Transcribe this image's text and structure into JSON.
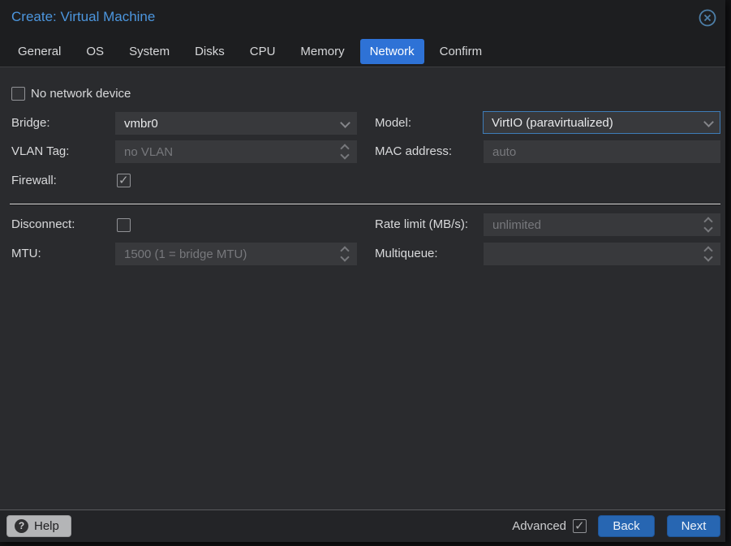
{
  "window": {
    "title": "Create: Virtual Machine"
  },
  "tabs": [
    {
      "label": "General",
      "active": false
    },
    {
      "label": "OS",
      "active": false
    },
    {
      "label": "System",
      "active": false
    },
    {
      "label": "Disks",
      "active": false
    },
    {
      "label": "CPU",
      "active": false
    },
    {
      "label": "Memory",
      "active": false
    },
    {
      "label": "Network",
      "active": true
    },
    {
      "label": "Confirm",
      "active": false
    }
  ],
  "form": {
    "no_network_device": {
      "label": "No network device",
      "checked": false
    },
    "bridge": {
      "label": "Bridge:",
      "value": "vmbr0"
    },
    "model": {
      "label": "Model:",
      "value": "VirtIO (paravirtualized)",
      "focused": true
    },
    "vlan_tag": {
      "label": "VLAN Tag:",
      "placeholder": "no VLAN"
    },
    "mac_address": {
      "label": "MAC address:",
      "placeholder": "auto"
    },
    "firewall": {
      "label": "Firewall:",
      "checked": true
    },
    "disconnect": {
      "label": "Disconnect:",
      "checked": false
    },
    "rate_limit": {
      "label": "Rate limit (MB/s):",
      "placeholder": "unlimited"
    },
    "mtu": {
      "label": "MTU:",
      "placeholder": "1500 (1 = bridge MTU)"
    },
    "multiqueue": {
      "label": "Multiqueue:",
      "placeholder": ""
    }
  },
  "footer": {
    "help": "Help",
    "advanced_label": "Advanced",
    "advanced_checked": true,
    "back": "Back",
    "next": "Next"
  },
  "colors": {
    "title_text": "#4c96de",
    "active_tab": "#2e72d6",
    "primary_button": "#2766b2",
    "field_background": "#38393c",
    "placeholder_text": "#77787c",
    "dialog_body": "#2a2b2e",
    "header": "#1d1e20",
    "divider": "#dedede"
  }
}
